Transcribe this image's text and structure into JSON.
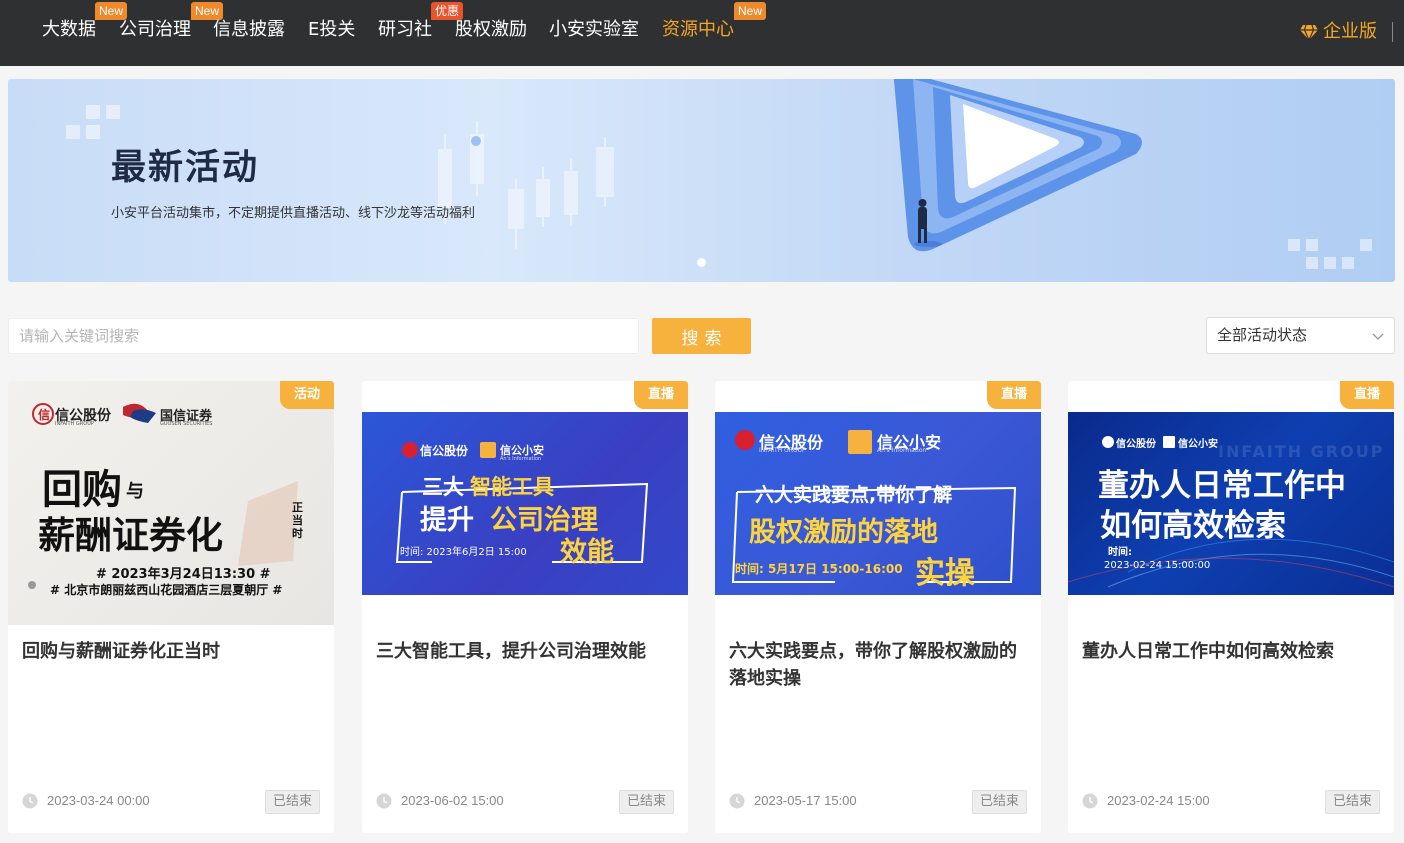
{
  "nav": {
    "items": [
      {
        "label": "大数据",
        "badge": "New"
      },
      {
        "label": "公司治理",
        "badge": "New"
      },
      {
        "label": "信息披露",
        "badge": ""
      },
      {
        "label": "E投关",
        "badge": ""
      },
      {
        "label": "研习社",
        "badge": "优惠"
      },
      {
        "label": "股权激励",
        "badge": ""
      },
      {
        "label": "小安实验室",
        "badge": ""
      },
      {
        "label": "资源中心",
        "badge": "New"
      }
    ],
    "enterprise_label": "企业版",
    "active_color": "#f5a623"
  },
  "banner": {
    "title": "最新活动",
    "subtitle": "小安平台活动集市，不定期提供直播活动、线下沙龙等活动福利"
  },
  "search": {
    "placeholder": "请输入关键词搜索",
    "button_label": "搜索",
    "status_select_value": "全部活动状态"
  },
  "cards": [
    {
      "tag": "活动",
      "title": "回购与薪酬证券化正当时",
      "date": "2023-03-24 00:00",
      "status": "已结束",
      "poster": {
        "brand_a": "信公股份",
        "brand_a_en": "INFAITH GROUP",
        "brand_b": "国信证券",
        "brand_b_en": "GUOSEN SECURITIES",
        "line1": "回购",
        "line1_small": "与",
        "line2": "薪酬证券化",
        "side": "正当时",
        "datetime": "# 2023年3月24日13:30 #",
        "location": "# 北京市朗丽兹西山花园酒店三层夏朝厅 #"
      }
    },
    {
      "tag": "直播",
      "title": "三大智能工具，提升公司治理效能",
      "date": "2023-06-02 15:00",
      "status": "已结束",
      "poster": {
        "brand_a": "信公股份",
        "brand_b": "信公小安",
        "brand_b_en": "An's Information",
        "line1": "三大",
        "line1_hl": "智能工具",
        "line2": "提升",
        "line2_hl": "公司治理",
        "line3": "效能",
        "time": "时间: 2023年6月2日 15:00"
      }
    },
    {
      "tag": "直播",
      "title": "六大实践要点，带你了解股权激励的落地实操",
      "date": "2023-05-17 15:00",
      "status": "已结束",
      "poster": {
        "brand_a": "信公股份",
        "brand_a_en": "INFAITH GROUP",
        "brand_b": "信公小安",
        "brand_b_en": "An's Information",
        "line1": "六大实践要点,带你了解",
        "line2": "股权激励的落地",
        "line3": "实操",
        "time": "时间: 5月17日 15:00-16:00"
      }
    },
    {
      "tag": "直播",
      "title": "董办人日常工作中如何高效检索",
      "date": "2023-02-24 15:00",
      "status": "已结束",
      "poster": {
        "brand_a": "信公股份",
        "brand_b": "信公小安",
        "watermark": "INFAITH GROUP",
        "line1": "董办人日常工作中",
        "line2": "如何高效检索",
        "time_label": "时间:",
        "time": "2023-02-24   15:00:00"
      }
    }
  ]
}
